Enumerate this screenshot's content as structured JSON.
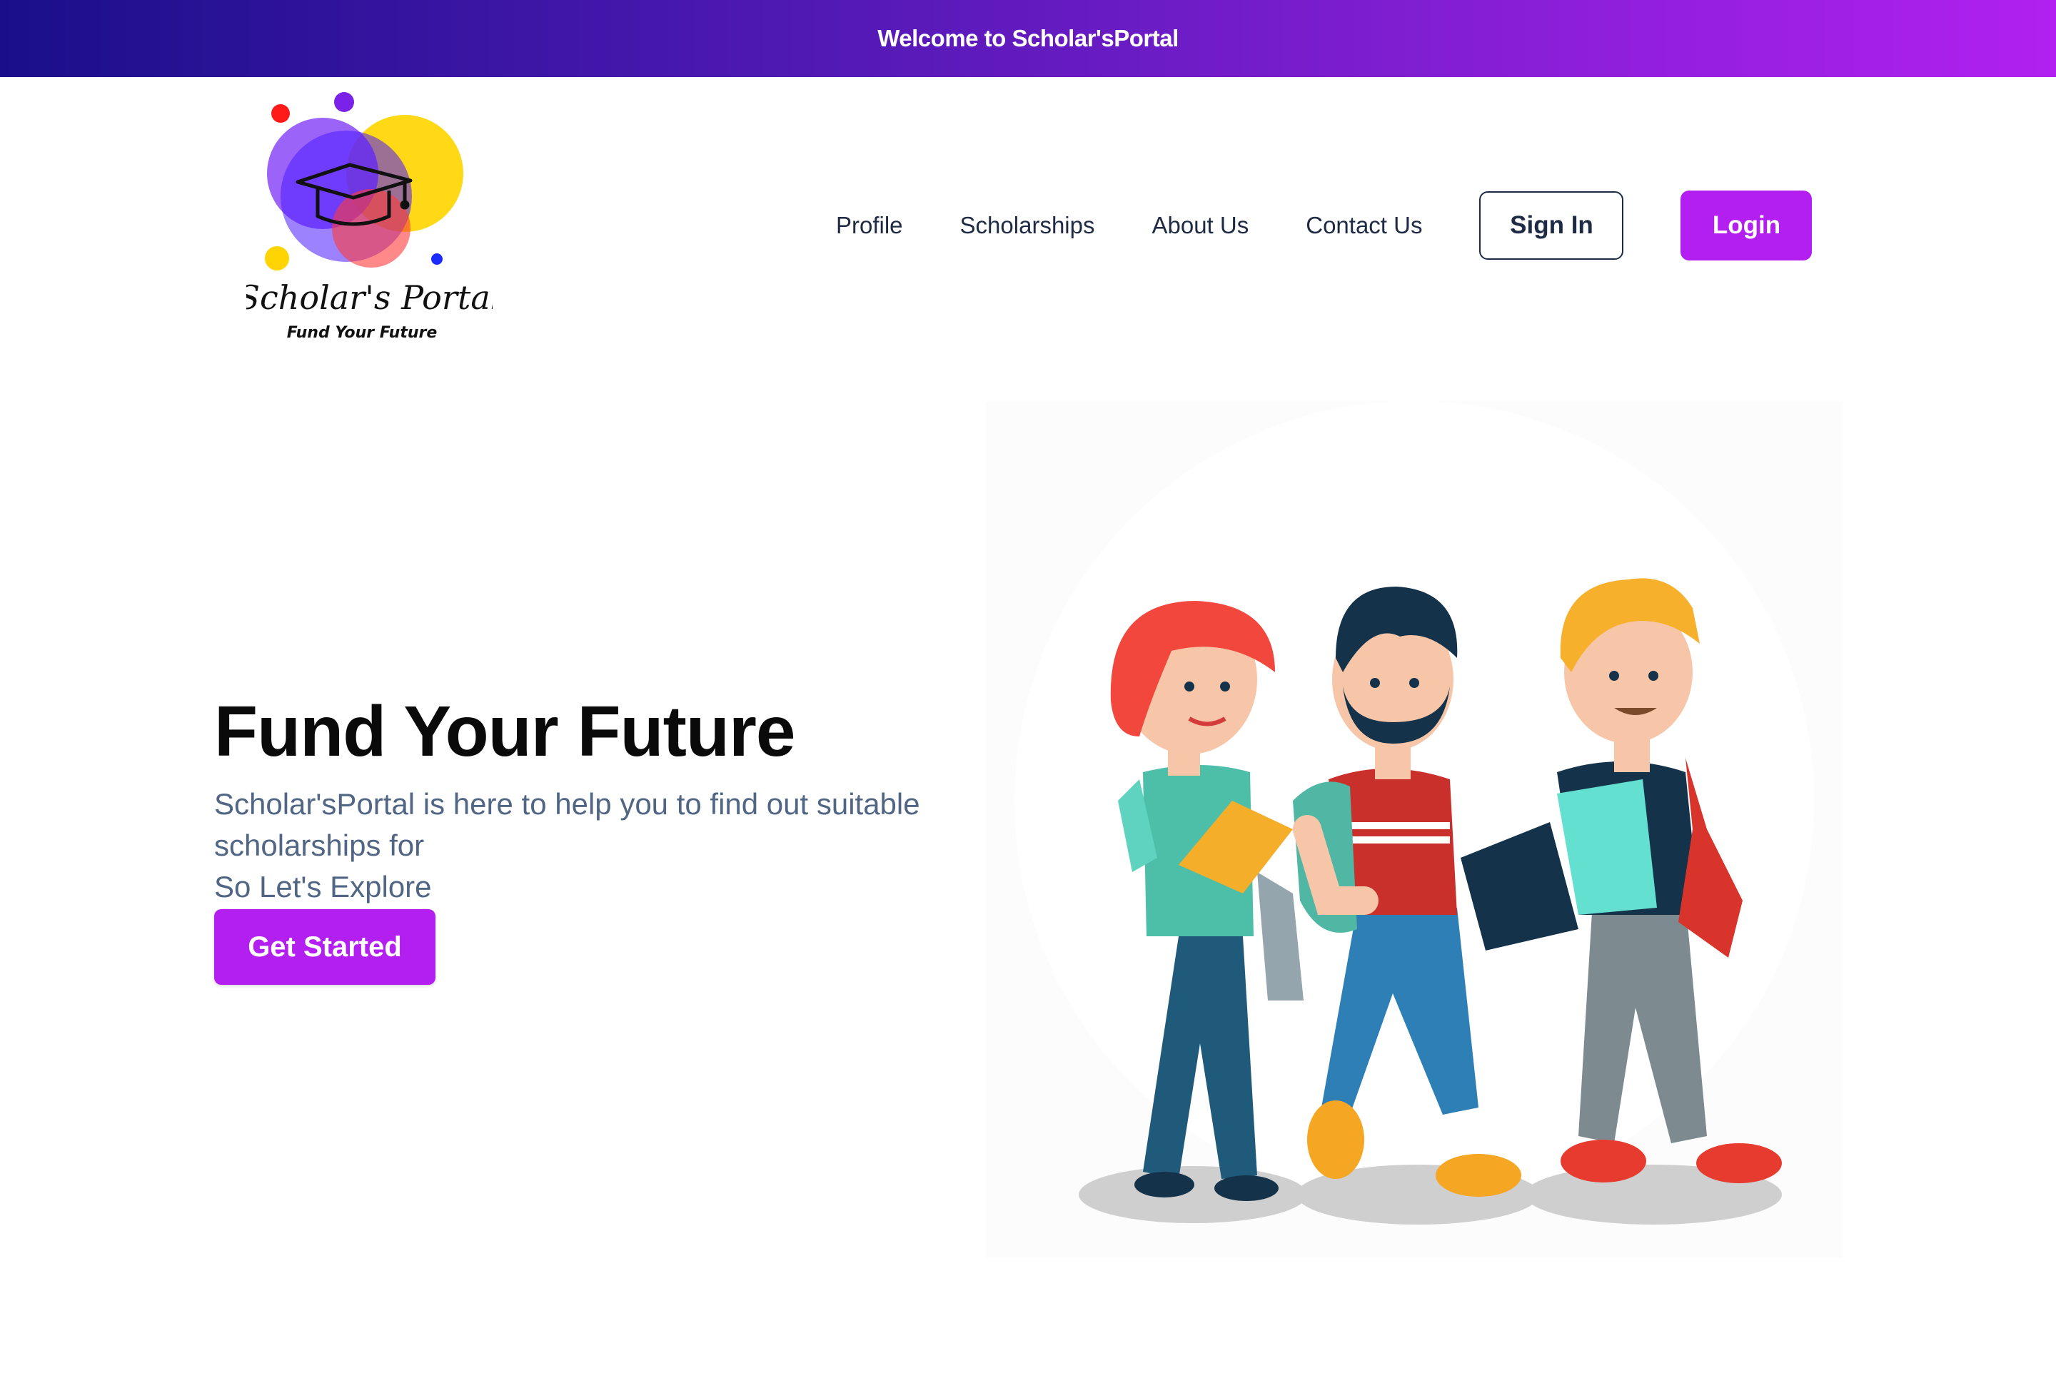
{
  "banner": {
    "text": "Welcome to Scholar'sPortal"
  },
  "logo": {
    "name": "Scholar's Portal",
    "tagline": "Fund Your Future"
  },
  "nav": {
    "items": [
      "Profile",
      "Scholarships",
      "About Us",
      "Contact Us"
    ],
    "signin_label": "Sign In",
    "login_label": "Login"
  },
  "hero": {
    "title": "Fund Your Future",
    "description_lines": [
      "Scholar'sPortal is here to help you to find out suitable",
      "scholarships for",
      "So Let's Explore"
    ],
    "cta_label": "Get Started"
  },
  "colors": {
    "accent": "#b31ff0",
    "banner_start": "#1a0f8a",
    "banner_end": "#b120f0",
    "nav_text": "#1f2a44",
    "desc_text": "#506684"
  },
  "icons": [
    "graduation-cap-icon"
  ]
}
